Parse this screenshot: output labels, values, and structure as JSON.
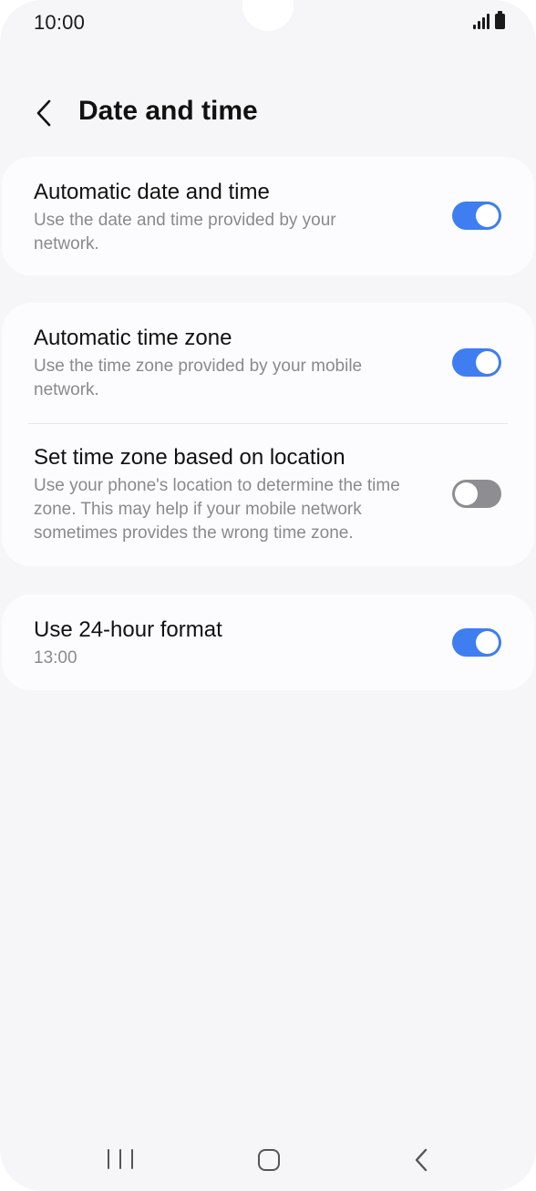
{
  "status_bar": {
    "time": "10:00"
  },
  "header": {
    "title": "Date and time"
  },
  "settings": {
    "auto_date_time": {
      "title": "Automatic date and time",
      "description": "Use the date and time provided by your network.",
      "enabled": true
    },
    "auto_time_zone": {
      "title": "Automatic time zone",
      "description": "Use the time zone provided by your mobile network.",
      "enabled": true
    },
    "location_time_zone": {
      "title": "Set time zone based on location",
      "description": "Use your phone's location to determine the time zone. This may help if your mobile network sometimes provides the wrong time zone.",
      "enabled": false
    },
    "format_24h": {
      "title": "Use 24-hour format",
      "description": "13:00",
      "enabled": true
    }
  },
  "colors": {
    "toggle_on": "#3e7ef0",
    "toggle_off": "#8e8e92",
    "background": "#f6f6f8",
    "card": "#fcfcfe"
  },
  "icons": {
    "back": "chevron-left-icon",
    "signal": "signal-icon",
    "battery": "battery-icon",
    "nav_recents": "recents-icon",
    "nav_home": "home-icon",
    "nav_back": "back-icon"
  }
}
